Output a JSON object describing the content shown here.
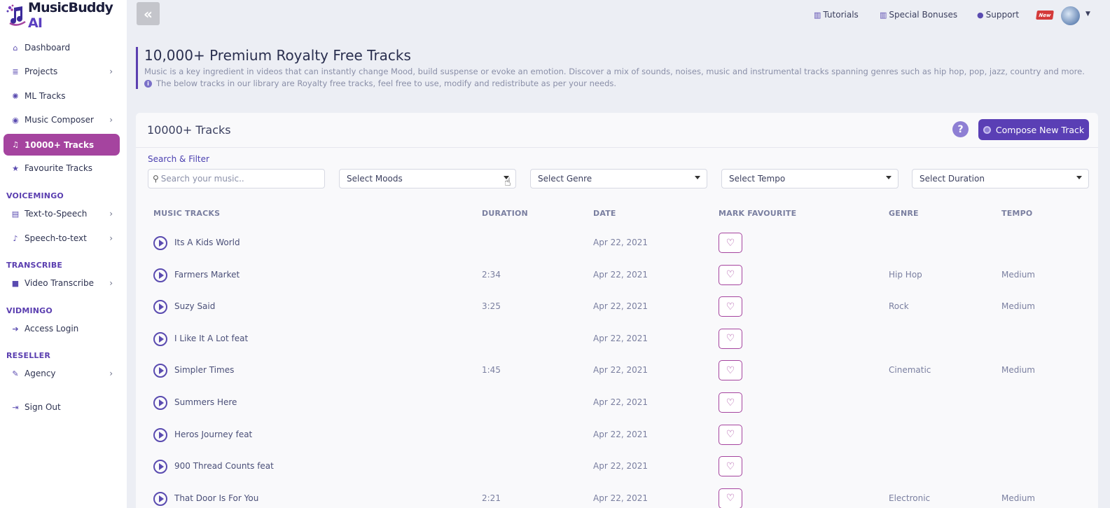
{
  "brand": {
    "name": "MusicBuddy",
    "suffix": " AI"
  },
  "sidebar": {
    "items": [
      {
        "label": "Dashboard",
        "icon": "home-icon",
        "glyph": "⌂",
        "chevron": false
      },
      {
        "label": "Projects",
        "icon": "list-icon",
        "glyph": "≣",
        "chevron": true
      },
      {
        "label": "ML Tracks",
        "icon": "badge-icon",
        "glyph": "✺",
        "chevron": false
      },
      {
        "label": "Music Composer",
        "icon": "disc-icon",
        "glyph": "◉",
        "chevron": true
      },
      {
        "label": "10000+ Tracks",
        "icon": "music-list-icon",
        "glyph": "♫",
        "chevron": false,
        "active": true
      },
      {
        "label": "Favourite Tracks",
        "icon": "star-icon",
        "glyph": "★",
        "chevron": false
      }
    ],
    "sections": [
      {
        "title": "VOICEMINGO",
        "items": [
          {
            "label": "Text-to-Speech",
            "icon": "chat-icon",
            "glyph": "▤",
            "chevron": true
          },
          {
            "label": "Speech-to-text",
            "icon": "mic-icon",
            "glyph": "♪",
            "chevron": true
          }
        ]
      },
      {
        "title": "TRANSCRIBE",
        "items": [
          {
            "label": "Video Transcribe",
            "icon": "video-icon",
            "glyph": "■",
            "chevron": true
          }
        ]
      },
      {
        "title": "VIDMINGO",
        "items": [
          {
            "label": "Access Login",
            "icon": "login-icon",
            "glyph": "➔",
            "chevron": false
          }
        ]
      },
      {
        "title": "RESELLER",
        "items": [
          {
            "label": "Agency",
            "icon": "wrench-icon",
            "glyph": "✎",
            "chevron": true
          }
        ]
      }
    ],
    "signout": {
      "label": "Sign Out",
      "icon": "signout-icon",
      "glyph": "⇥"
    }
  },
  "topbar": {
    "tutorials": "Tutorials",
    "bonuses": "Special Bonuses",
    "support": "Support",
    "new_badge": "New"
  },
  "header": {
    "title": "10,000+ Premium Royalty Free Tracks",
    "description": "Music is a key ingredient in videos that can instantly change Mood, build suspense or evoke an emotion. Discover a mix of sounds, noises, music and instrumental tracks spanning genres such as hip hop, pop, jazz, country and more.",
    "note": "The below tracks in our library are Royalty free tracks, feel free to use, modify and redistribute as per your needs."
  },
  "card": {
    "title": "10000+ Tracks",
    "help": "?",
    "compose_label": "Compose New Track",
    "filter_label": "Search & Filter",
    "search_placeholder": "Search your music..",
    "selects": [
      "Select Moods",
      "Select Genre",
      "Select Tempo",
      "Select Duration"
    ]
  },
  "table": {
    "columns": [
      "MUSIC TRACKS",
      "DURATION",
      "DATE",
      "MARK FAVOURITE",
      "GENRE",
      "TEMPO"
    ],
    "rows": [
      {
        "title": "Its A Kids World",
        "duration": "",
        "date": "Apr 22, 2021",
        "genre": "",
        "tempo": ""
      },
      {
        "title": "Farmers Market",
        "duration": "2:34",
        "date": "Apr 22, 2021",
        "genre": "Hip Hop",
        "tempo": "Medium"
      },
      {
        "title": "Suzy Said",
        "duration": "3:25",
        "date": "Apr 22, 2021",
        "genre": "Rock",
        "tempo": "Medium"
      },
      {
        "title": "I Like It A Lot feat",
        "duration": "",
        "date": "Apr 22, 2021",
        "genre": "",
        "tempo": ""
      },
      {
        "title": "Simpler Times",
        "duration": "1:45",
        "date": "Apr 22, 2021",
        "genre": "Cinematic",
        "tempo": "Medium"
      },
      {
        "title": "Summers Here",
        "duration": "",
        "date": "Apr 22, 2021",
        "genre": "",
        "tempo": ""
      },
      {
        "title": "Heros Journey feat",
        "duration": "",
        "date": "Apr 22, 2021",
        "genre": "",
        "tempo": ""
      },
      {
        "title": "900 Thread Counts feat",
        "duration": "",
        "date": "Apr 22, 2021",
        "genre": "",
        "tempo": ""
      },
      {
        "title": "That Door Is For You",
        "duration": "2:21",
        "date": "Apr 22, 2021",
        "genre": "Electronic",
        "tempo": "Medium"
      }
    ]
  },
  "colors": {
    "accent": "#5a3fb5",
    "active_nav": "#a5449f",
    "background": "#eceef4"
  }
}
